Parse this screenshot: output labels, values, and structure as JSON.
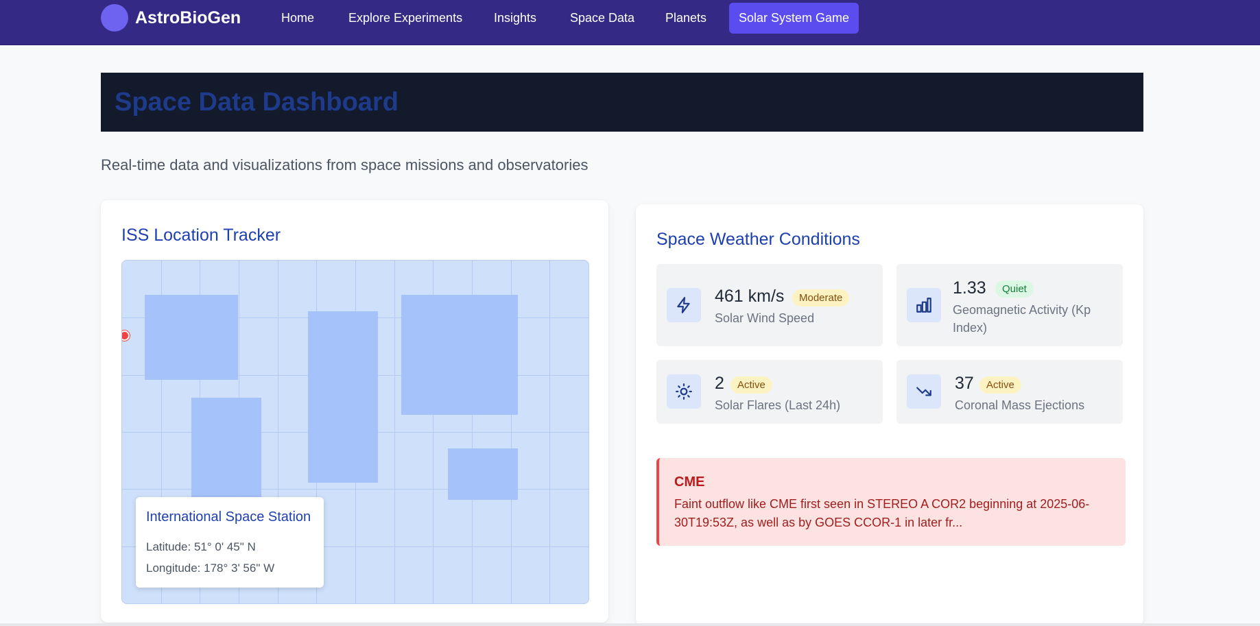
{
  "brand": {
    "name": "AstroBioGen"
  },
  "nav": {
    "items": [
      {
        "label": "Home"
      },
      {
        "label": "Explore Experiments"
      },
      {
        "label": "Insights"
      },
      {
        "label": "Space Data"
      },
      {
        "label": "Planets"
      },
      {
        "label": "Solar System Game",
        "active": true
      }
    ]
  },
  "hero": {
    "title": "Space Data Dashboard"
  },
  "subtitle": "Real-time data and visualizations from space missions and observatories",
  "iss": {
    "title": "ISS Location Tracker",
    "popup": {
      "name": "International Space Station",
      "latitude": "Latitude: 51° 0' 45\" N",
      "longitude": "Longitude: 178° 3' 56\" W"
    }
  },
  "weather": {
    "title": "Space Weather Conditions",
    "tiles": [
      {
        "icon": "lightning-icon",
        "value": "461 km/s",
        "badge": "Moderate",
        "label": "Solar Wind Speed"
      },
      {
        "icon": "bar-chart-icon",
        "value": "1.33",
        "badge": "Quiet",
        "label": "Geomagnetic Activity (Kp Index)"
      },
      {
        "icon": "sun-icon",
        "value": "2",
        "badge": "Active",
        "label": "Solar Flares (Last 24h)"
      },
      {
        "icon": "trending-down-icon",
        "value": "37",
        "badge": "Active",
        "label": "Coronal Mass Ejections"
      }
    ],
    "alert": {
      "title": "CME",
      "text": "Faint outflow like CME first seen in STEREO A COR2 beginning at 2025-06-30T19:53Z, as well as by GOES CCOR-1 in later fr..."
    }
  },
  "colors": {
    "nav_bg": "#342a86",
    "nav_active": "#5b4cf0",
    "accent": "#1e40af",
    "alert_red": "#ef4444"
  }
}
